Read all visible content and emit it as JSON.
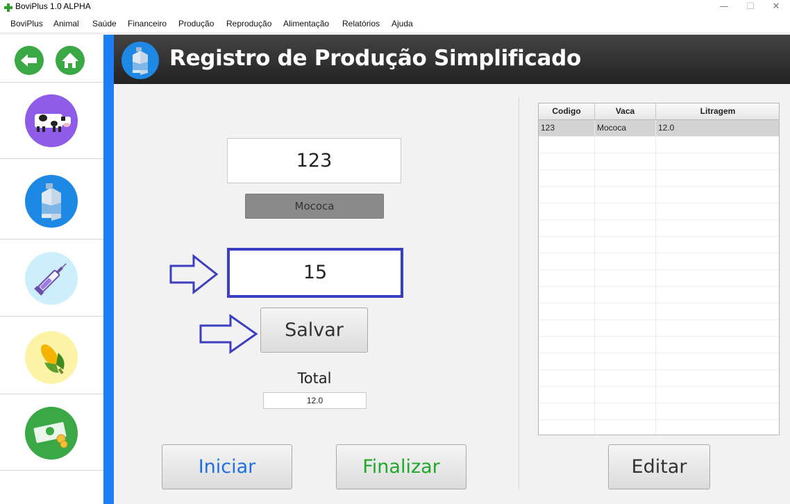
{
  "window": {
    "title": "BoviPlus 1.0 ALPHA",
    "minimize": "—",
    "maximize": "☐",
    "close": "✕"
  },
  "menu": [
    "BoviPlus",
    "Animal",
    "Saúde",
    "Financeiro",
    "Produção",
    "Reprodução",
    "Alimentação",
    "Relatórios",
    "Ajuda"
  ],
  "sidebar": {
    "back_icon": "arrow-left-icon",
    "home_icon": "home-icon",
    "items": [
      "cow-icon",
      "milk-carton-icon",
      "syringe-icon",
      "corn-icon",
      "money-icon"
    ]
  },
  "header": {
    "title": "Registro de Produção Simplificado",
    "icon": "milk-carton-icon"
  },
  "form": {
    "code_value": "123",
    "cow_name": "Mococa",
    "liters_value": "15",
    "save_label": "Salvar",
    "total_label": "Total",
    "total_value": "12.0"
  },
  "buttons": {
    "start": "Iniciar",
    "finish": "Finalizar",
    "edit": "Editar"
  },
  "table": {
    "headers": [
      "Codigo",
      "Vaca",
      "Litragem"
    ],
    "rows": [
      [
        "123",
        "Mococa",
        "12.0"
      ]
    ]
  },
  "colors": {
    "accent_blue": "#1c7ef5",
    "start_text": "#1f6fe0",
    "finish_text": "#1fa82a",
    "arrow": "#3b3fbf"
  }
}
